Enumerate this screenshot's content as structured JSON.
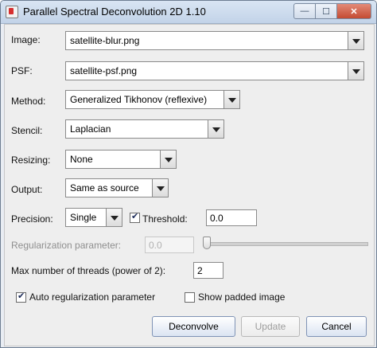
{
  "window": {
    "title": "Parallel Spectral Deconvolution 2D 1.10",
    "controls": {
      "minimize": "—",
      "maximize": "☐",
      "close": "✕"
    }
  },
  "form": {
    "image": {
      "label": "Image:",
      "value": "satellite-blur.png"
    },
    "psf": {
      "label": "PSF:",
      "value": "satellite-psf.png"
    },
    "method": {
      "label": "Method:",
      "value": "Generalized Tikhonov (reflexive)"
    },
    "stencil": {
      "label": "Stencil:",
      "value": "Laplacian"
    },
    "resizing": {
      "label": "Resizing:",
      "value": "None"
    },
    "output": {
      "label": "Output:",
      "value": "Same as source"
    },
    "precision": {
      "label": "Precision:",
      "value": "Single"
    },
    "threshold": {
      "label": "Threshold:",
      "checked": true,
      "value": "0.0"
    },
    "regularization": {
      "label": "Regularization parameter:",
      "value": "0.0",
      "slider_fraction": 0.0
    },
    "threads": {
      "label": "Max number of threads (power of 2):",
      "value": "2"
    },
    "auto_regularization": {
      "label": "Auto regularization parameter",
      "checked": true
    },
    "show_padded": {
      "label": "Show padded image",
      "checked": false
    }
  },
  "buttons": {
    "deconvolve": "Deconvolve",
    "update": "Update",
    "cancel": "Cancel"
  }
}
